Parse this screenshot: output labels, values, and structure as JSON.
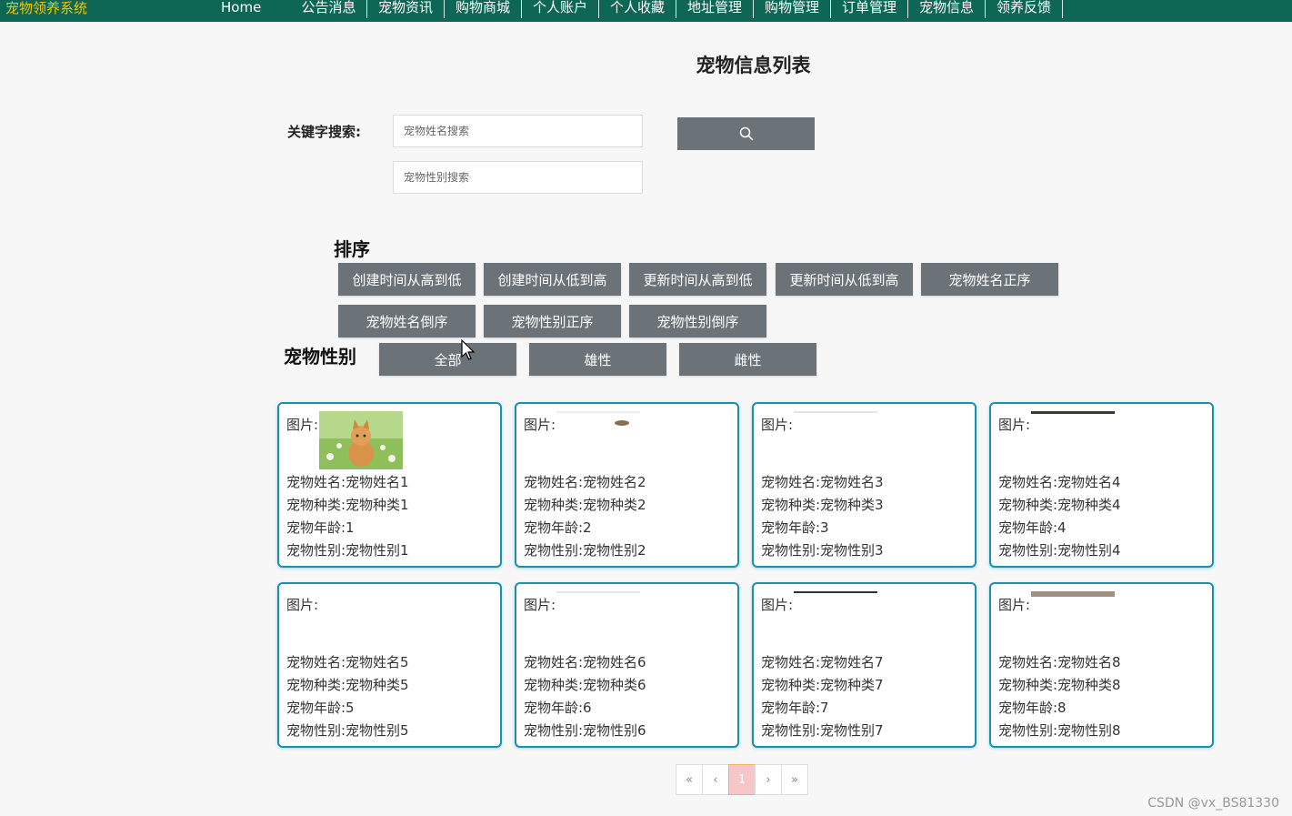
{
  "nav": {
    "brand": "宠物领养系统",
    "home": "Home",
    "items": [
      "公告消息",
      "宠物资讯",
      "购物商城",
      "个人账户",
      "个人收藏",
      "地址管理",
      "购物管理",
      "订单管理",
      "宠物信息",
      "领养反馈"
    ]
  },
  "page": {
    "title": "宠物信息列表"
  },
  "search": {
    "label": "关键字搜索:",
    "name_placeholder": "宠物姓名搜索",
    "gender_placeholder": "宠物性别搜索",
    "button_icon": "search-icon"
  },
  "sort": {
    "label": "排序",
    "buttons": [
      "创建时间从高到低",
      "创建时间从低到高",
      "更新时间从高到低",
      "更新时间从低到高",
      "宠物姓名正序",
      "宠物姓名倒序",
      "宠物性别正序",
      "宠物性别倒序"
    ]
  },
  "gender_filter": {
    "label": "宠物性别",
    "buttons": [
      "全部",
      "雄性",
      "雌性"
    ]
  },
  "cards": [
    {
      "img_label": "图片:",
      "name": "宠物姓名:宠物姓名1",
      "kind": "宠物种类:宠物种类1",
      "age": "宠物年龄:1",
      "gender": "宠物性别:宠物性别1"
    },
    {
      "img_label": "图片:",
      "name": "宠物姓名:宠物姓名2",
      "kind": "宠物种类:宠物种类2",
      "age": "宠物年龄:2",
      "gender": "宠物性别:宠物性别2"
    },
    {
      "img_label": "图片:",
      "name": "宠物姓名:宠物姓名3",
      "kind": "宠物种类:宠物种类3",
      "age": "宠物年龄:3",
      "gender": "宠物性别:宠物性别3"
    },
    {
      "img_label": "图片:",
      "name": "宠物姓名:宠物姓名4",
      "kind": "宠物种类:宠物种类4",
      "age": "宠物年龄:4",
      "gender": "宠物性别:宠物性别4"
    },
    {
      "img_label": "图片:",
      "name": "宠物姓名:宠物姓名5",
      "kind": "宠物种类:宠物种类5",
      "age": "宠物年龄:5",
      "gender": "宠物性别:宠物性别5"
    },
    {
      "img_label": "图片:",
      "name": "宠物姓名:宠物姓名6",
      "kind": "宠物种类:宠物种类6",
      "age": "宠物年龄:6",
      "gender": "宠物性别:宠物性别6"
    },
    {
      "img_label": "图片:",
      "name": "宠物姓名:宠物姓名7",
      "kind": "宠物种类:宠物种类7",
      "age": "宠物年龄:7",
      "gender": "宠物性别:宠物性别7"
    },
    {
      "img_label": "图片:",
      "name": "宠物姓名:宠物姓名8",
      "kind": "宠物种类:宠物种类8",
      "age": "宠物年龄:8",
      "gender": "宠物性别:宠物性别8"
    }
  ],
  "pagination": {
    "first": "«",
    "prev": "‹",
    "current": "1",
    "next": "›",
    "last": "»"
  },
  "watermark": "CSDN @vx_BS81330",
  "colors": {
    "nav_bg": "#0e6655",
    "brand": "#f1c40f",
    "button_bg": "#6b7378",
    "card_border": "#1a8fb0",
    "page_active": "#f7c6c6"
  }
}
